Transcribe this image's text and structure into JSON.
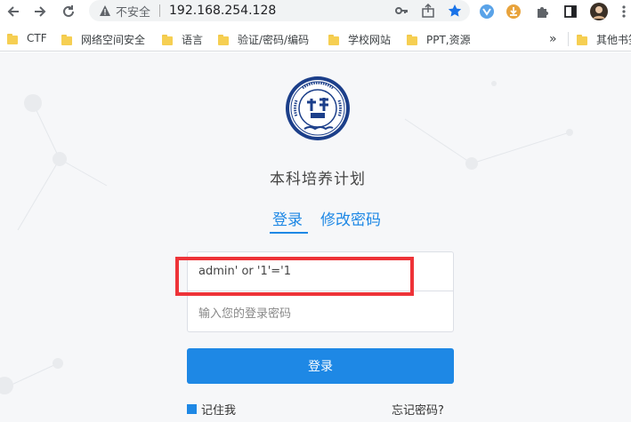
{
  "browser": {
    "insecure_label": "不安全",
    "url": "192.168.254.128",
    "bookmarks": [
      {
        "label": "CTF"
      },
      {
        "label": "网络空间安全"
      },
      {
        "label": "语言"
      },
      {
        "label": "验证/密码/编码"
      },
      {
        "label": "学校网站"
      },
      {
        "label": "PPT,资源"
      }
    ],
    "more_label": "»",
    "other_bookmarks": "其他书签"
  },
  "page": {
    "site_title": "本科培养计划",
    "tabs": [
      {
        "label": "登录",
        "active": true
      },
      {
        "label": "修改密码",
        "active": false
      }
    ],
    "username_value": "admin' or '1'='1",
    "password_placeholder": "输入您的登录密码",
    "login_button": "登录",
    "remember_label": "记住我",
    "forgot_label": "忘记密码?",
    "accent_color": "#1e88e5",
    "highlight_color": "#ee3338"
  }
}
